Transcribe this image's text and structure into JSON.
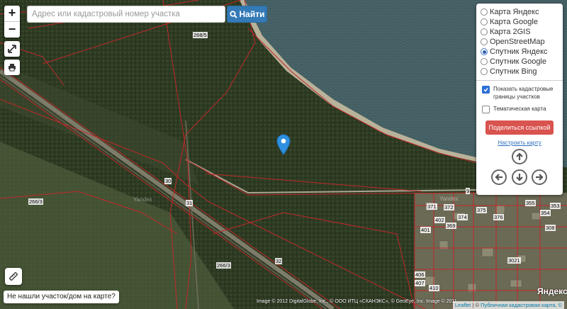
{
  "search": {
    "placeholder": "Адрес или кадастровый номер участка",
    "button_label": "Найти"
  },
  "zoom": {
    "in_label": "+",
    "out_label": "−"
  },
  "layers": [
    {
      "label": "Карта Яндекс",
      "selected": false
    },
    {
      "label": "Карта Google",
      "selected": false
    },
    {
      "label": "Карта 2GIS",
      "selected": false
    },
    {
      "label": "OpenStreetMap",
      "selected": false
    },
    {
      "label": "Спутник Яндекс",
      "selected": true
    },
    {
      "label": "Спутник Google",
      "selected": false
    },
    {
      "label": "Спутник Bing",
      "selected": false
    }
  ],
  "options": [
    {
      "label": "Показать кадастровые границы участков",
      "checked": true
    },
    {
      "label": "Тематическая карта",
      "checked": false
    }
  ],
  "share_label": "Поделиться ссылкой",
  "configure_label": "Настроить карту",
  "not_found_label": "Не нашли участок/дом на карте?",
  "parcel_labels": [
    "268/5",
    "30",
    "266/3",
    "31",
    "266/3",
    "32",
    "9",
    "374",
    "375",
    "376",
    "371",
    "372",
    "401",
    "402",
    "369",
    "308",
    "3021",
    "406",
    "407",
    "410",
    "355",
    "354",
    "353"
  ],
  "watermark": "Yandex",
  "credits": "Image © 2012 DigitalGlobe, Inc., © ООО ИТЦ «СКАНЭКС», © GeoEye, Inc. Image © 2011 ...",
  "attribution": {
    "leaflet": "Leaflet",
    "sep": " | © ",
    "source": "Публичная кадастровая карта, ©"
  },
  "logo": "Яндекс",
  "colors": {
    "water": "#3f5a5e",
    "forest": "#2d3a22",
    "parcel_border": "#c0282a",
    "accent": "#337ab7",
    "share": "#d9534f"
  }
}
